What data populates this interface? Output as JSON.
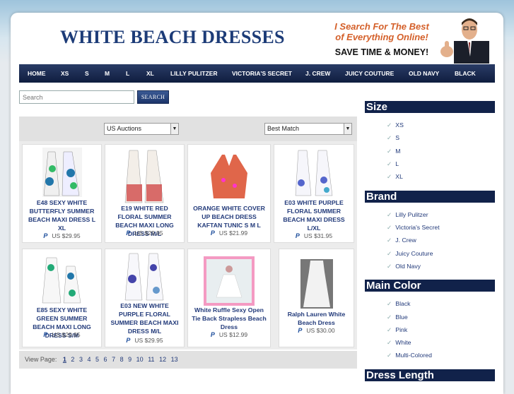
{
  "header": {
    "title": "WHITE BEACH DRESSES",
    "promo_line1": "I Search For The Best",
    "promo_line2": "of Everything Online!",
    "promo_line3": "SAVE TIME & MONEY!"
  },
  "nav": [
    "HOME",
    "XS",
    "S",
    "M",
    "L",
    "XL",
    "LILLY PULITZER",
    "VICTORIA'S SECRET",
    "J. CREW",
    "JUICY COUTURE",
    "OLD NAVY",
    "BLACK"
  ],
  "search": {
    "placeholder": "Search",
    "button": "SEARCH"
  },
  "filters": {
    "auction": "US Auctions",
    "sort": "Best Match"
  },
  "products": [
    {
      "name": "E48 SEXY WHITE BUTTERFLY SUMMER BEACH MAXI DRESS L XL",
      "price": "US $29.95"
    },
    {
      "name": "E19 WHITE RED FLORAL SUMMER BEACH MAXI LONG DRESS M/L",
      "price": "US $29.95"
    },
    {
      "name": "ORANGE WHITE COVER UP BEACH DRESS KAFTAN TUNIC S M L",
      "price": "US $21.99"
    },
    {
      "name": "E03 WHITE PURPLE FLORAL SUMMER BEACH MAXI DRESS L/XL",
      "price": "US $31.95"
    },
    {
      "name": "E85 SEXY WHITE GREEN SUMMER BEACH MAXI LONG DRESS S/M",
      "price": "US $29.95"
    },
    {
      "name": "E03 NEW WHITE PURPLE FLORAL SUMMER BEACH MAXI DRESS M/L",
      "price": "US $29.95"
    },
    {
      "name": "White Ruffle Sexy Open Tie Back Strapless Beach Dress",
      "price": "US $12.99"
    },
    {
      "name": "Ralph Lauren White Beach Dress",
      "price": "US $30.00"
    }
  ],
  "pager": {
    "label": "View Page:",
    "pages": [
      "1",
      "2",
      "3",
      "4",
      "5",
      "6",
      "7",
      "8",
      "9",
      "10",
      "11",
      "12",
      "13"
    ],
    "current": "1"
  },
  "sidebar": {
    "size": {
      "heading": "Size",
      "items": [
        "XS",
        "S",
        "M",
        "L",
        "XL"
      ]
    },
    "brand": {
      "heading": "Brand",
      "items": [
        "Lilly Pulitzer",
        "Victoria's Secret",
        "J. Crew",
        "Juicy Couture",
        "Old Navy"
      ]
    },
    "color": {
      "heading": "Main Color",
      "items": [
        "Black",
        "Blue",
        "Pink",
        "White",
        "Multi-Colored"
      ]
    },
    "length": {
      "heading": "Dress Length"
    }
  },
  "icons": {
    "paypal": "paypal-icon",
    "check": "check-icon",
    "dropdown": "chevron-down-icon"
  },
  "colors": {
    "nav_bg": "#11224a",
    "title": "#1d3c78",
    "promo": "#d4602a",
    "link": "#223a7a"
  }
}
